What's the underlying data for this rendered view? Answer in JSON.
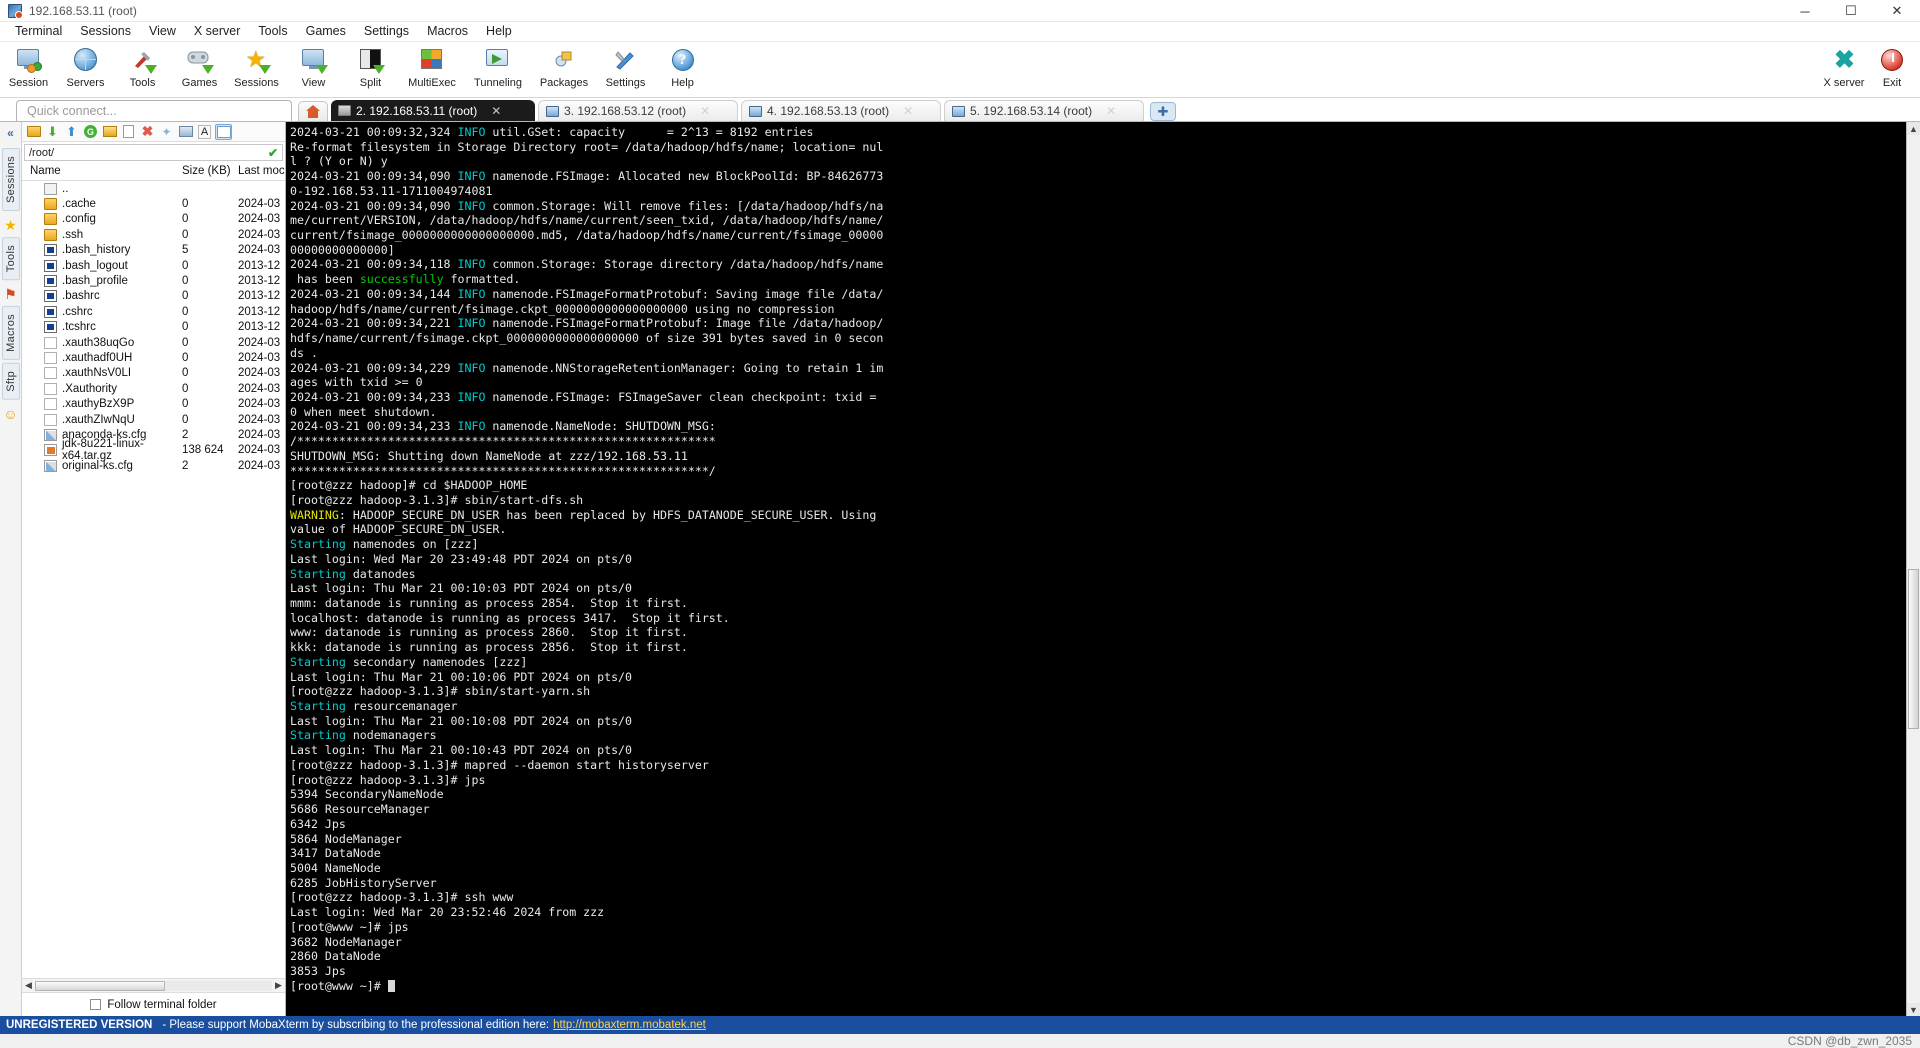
{
  "window": {
    "title": "192.168.53.11 (root)",
    "icon": "mobaxterm-icon",
    "minimize": "─",
    "maximize": "☐",
    "close": "✕"
  },
  "menubar": {
    "items": [
      "Terminal",
      "Sessions",
      "View",
      "X server",
      "Tools",
      "Games",
      "Settings",
      "Macros",
      "Help"
    ]
  },
  "toolbar": {
    "buttons": [
      {
        "label": "Session",
        "icon": "session-icon"
      },
      {
        "label": "Servers",
        "icon": "servers-globe-icon"
      },
      {
        "label": "Tools",
        "icon": "tools-wrench-icon"
      },
      {
        "label": "Games",
        "icon": "games-gamepad-icon"
      },
      {
        "label": "Sessions",
        "icon": "sessions-star-icon"
      },
      {
        "label": "View",
        "icon": "view-monitor-icon"
      },
      {
        "label": "Split",
        "icon": "split-icon"
      },
      {
        "label": "MultiExec",
        "icon": "multiexec-icon"
      },
      {
        "label": "Tunneling",
        "icon": "tunneling-icon"
      },
      {
        "label": "Packages",
        "icon": "packages-icon"
      },
      {
        "label": "Settings",
        "icon": "settings-icon"
      },
      {
        "label": "Help",
        "icon": "help-icon"
      }
    ],
    "right_buttons": [
      {
        "label": "X server",
        "icon": "xserver-icon"
      },
      {
        "label": "Exit",
        "icon": "exit-power-icon"
      }
    ]
  },
  "quick_connect": {
    "placeholder": "Quick connect..."
  },
  "tabs": {
    "home_icon": "home-icon",
    "new_tab_icon": "plus-icon",
    "close_glyph": "✕",
    "items": [
      {
        "label": "2. 192.168.53.11 (root)",
        "active": true
      },
      {
        "label": "3. 192.168.53.12 (root)",
        "active": false
      },
      {
        "label": "4. 192.168.53.13 (root)",
        "active": false
      },
      {
        "label": "5. 192.168.53.14 (root)",
        "active": false
      }
    ]
  },
  "rail": {
    "collapse": "«",
    "tabs": [
      "Sessions",
      "Tools",
      "Macros",
      "Sftp"
    ],
    "icons": [
      "star-icon",
      "flag-icon",
      "clock-icon",
      "smiley-icon"
    ]
  },
  "sftp": {
    "toolbar_icons": [
      "parent-folder-icon",
      "download-icon",
      "upload-icon",
      "refresh-icon",
      "new-folder-icon",
      "new-file-icon",
      "delete-icon",
      "permissions-icon",
      "terminal-icon",
      "text-mode-icon",
      "list-view-icon"
    ],
    "path": "/root/",
    "path_ok_icon": "checkmark-icon",
    "columns": [
      "Name",
      "Size (KB)",
      "Last moc"
    ],
    "rows": [
      {
        "name": "..",
        "size": "",
        "date": "",
        "icon": "parent-dir-icon"
      },
      {
        "name": ".cache",
        "size": "0",
        "date": "2024-03",
        "icon": "folder-icon"
      },
      {
        "name": ".config",
        "size": "0",
        "date": "2024-03",
        "icon": "folder-icon"
      },
      {
        "name": ".ssh",
        "size": "0",
        "date": "2024-03",
        "icon": "folder-icon"
      },
      {
        "name": ".bash_history",
        "size": "5",
        "date": "2024-03",
        "icon": "script-icon"
      },
      {
        "name": ".bash_logout",
        "size": "0",
        "date": "2013-12",
        "icon": "script-icon"
      },
      {
        "name": ".bash_profile",
        "size": "0",
        "date": "2013-12",
        "icon": "script-icon"
      },
      {
        "name": ".bashrc",
        "size": "0",
        "date": "2013-12",
        "icon": "script-icon"
      },
      {
        "name": ".cshrc",
        "size": "0",
        "date": "2013-12",
        "icon": "script-icon"
      },
      {
        "name": ".tcshrc",
        "size": "0",
        "date": "2013-12",
        "icon": "script-icon"
      },
      {
        "name": ".xauth38uqGo",
        "size": "0",
        "date": "2024-03",
        "icon": "plain-file-icon"
      },
      {
        "name": ".xauthadf0UH",
        "size": "0",
        "date": "2024-03",
        "icon": "plain-file-icon"
      },
      {
        "name": ".xauthNsV0LI",
        "size": "0",
        "date": "2024-03",
        "icon": "plain-file-icon"
      },
      {
        "name": ".Xauthority",
        "size": "0",
        "date": "2024-03",
        "icon": "plain-file-icon"
      },
      {
        "name": ".xauthyBzX9P",
        "size": "0",
        "date": "2024-03",
        "icon": "plain-file-icon"
      },
      {
        "name": ".xauthZIwNqU",
        "size": "0",
        "date": "2024-03",
        "icon": "plain-file-icon"
      },
      {
        "name": "anaconda-ks.cfg",
        "size": "2",
        "date": "2024-03",
        "icon": "cfg-file-icon"
      },
      {
        "name": "jdk-8u221-linux-x64.tar.gz",
        "size": "138 624",
        "date": "2024-03",
        "icon": "archive-icon"
      },
      {
        "name": "original-ks.cfg",
        "size": "2",
        "date": "2024-03",
        "icon": "cfg-file-icon"
      }
    ],
    "follow_label": "Follow terminal folder",
    "scroll_left": "◀",
    "scroll_right": "▶"
  },
  "terminal": {
    "scroll_up": "▲",
    "scroll_down": "▼",
    "lines": [
      [
        {
          "t": "2024-03-21 00:09:32,324 ",
          "c": "wh"
        },
        {
          "t": "INFO",
          "c": "cy"
        },
        {
          "t": " util.GSet: capacity      = 2^13 = 8192 entries",
          "c": "wh"
        }
      ],
      [
        {
          "t": "Re-format filesystem in Storage Directory root= /data/hadoop/hdfs/name; location= nul",
          "c": "wh"
        }
      ],
      [
        {
          "t": "l ? (Y or N) y",
          "c": "wh"
        }
      ],
      [
        {
          "t": "2024-03-21 00:09:34,090 ",
          "c": "wh"
        },
        {
          "t": "INFO",
          "c": "cy"
        },
        {
          "t": " namenode.FSImage: Allocated new BlockPoolId: BP-84626773",
          "c": "wh"
        }
      ],
      [
        {
          "t": "0-192.168.53.11-1711004974081",
          "c": "wh"
        }
      ],
      [
        {
          "t": "2024-03-21 00:09:34,090 ",
          "c": "wh"
        },
        {
          "t": "INFO",
          "c": "cy"
        },
        {
          "t": " common.Storage: Will remove files: [/data/hadoop/hdfs/na",
          "c": "wh"
        }
      ],
      [
        {
          "t": "me/current/VERSION, /data/hadoop/hdfs/name/current/seen_txid, /data/hadoop/hdfs/name/",
          "c": "wh"
        }
      ],
      [
        {
          "t": "current/fsimage_0000000000000000000.md5, /data/hadoop/hdfs/name/current/fsimage_00000",
          "c": "wh"
        }
      ],
      [
        {
          "t": "00000000000000]",
          "c": "wh"
        }
      ],
      [
        {
          "t": "2024-03-21 00:09:34,118 ",
          "c": "wh"
        },
        {
          "t": "INFO",
          "c": "cy"
        },
        {
          "t": " common.Storage: Storage directory /data/hadoop/hdfs/name",
          "c": "wh"
        }
      ],
      [
        {
          "t": " has been ",
          "c": "wh"
        },
        {
          "t": "successfully",
          "c": "gr"
        },
        {
          "t": " formatted.",
          "c": "wh"
        }
      ],
      [
        {
          "t": "2024-03-21 00:09:34,144 ",
          "c": "wh"
        },
        {
          "t": "INFO",
          "c": "cy"
        },
        {
          "t": " namenode.FSImageFormatProtobuf: Saving image file /data/",
          "c": "wh"
        }
      ],
      [
        {
          "t": "hadoop/hdfs/name/current/fsimage.ckpt_0000000000000000000 using no compression",
          "c": "wh"
        }
      ],
      [
        {
          "t": "2024-03-21 00:09:34,221 ",
          "c": "wh"
        },
        {
          "t": "INFO",
          "c": "cy"
        },
        {
          "t": " namenode.FSImageFormatProtobuf: Image file /data/hadoop/",
          "c": "wh"
        }
      ],
      [
        {
          "t": "hdfs/name/current/fsimage.ckpt_0000000000000000000 of size 391 bytes saved in 0 secon",
          "c": "wh"
        }
      ],
      [
        {
          "t": "ds .",
          "c": "wh"
        }
      ],
      [
        {
          "t": "2024-03-21 00:09:34,229 ",
          "c": "wh"
        },
        {
          "t": "INFO",
          "c": "cy"
        },
        {
          "t": " namenode.NNStorageRetentionManager: Going to retain 1 im",
          "c": "wh"
        }
      ],
      [
        {
          "t": "ages with txid >= 0",
          "c": "wh"
        }
      ],
      [
        {
          "t": "2024-03-21 00:09:34,233 ",
          "c": "wh"
        },
        {
          "t": "INFO",
          "c": "cy"
        },
        {
          "t": " namenode.FSImage: FSImageSaver clean checkpoint: txid =",
          "c": "wh"
        }
      ],
      [
        {
          "t": "0 when meet shutdown.",
          "c": "wh"
        }
      ],
      [
        {
          "t": "2024-03-21 00:09:34,233 ",
          "c": "wh"
        },
        {
          "t": "INFO",
          "c": "cy"
        },
        {
          "t": " namenode.NameNode: SHUTDOWN_MSG:",
          "c": "wh"
        }
      ],
      [
        {
          "t": "/************************************************************",
          "c": "wh"
        }
      ],
      [
        {
          "t": "SHUTDOWN_MSG: Shutting down NameNode at zzz/192.168.53.11",
          "c": "wh"
        }
      ],
      [
        {
          "t": "************************************************************/",
          "c": "wh"
        }
      ],
      [
        {
          "t": "[root@zzz hadoop]# cd $HADOOP_HOME",
          "c": "wh"
        }
      ],
      [
        {
          "t": "[root@zzz hadoop-3.1.3]# sbin/start-dfs.sh",
          "c": "wh"
        }
      ],
      [
        {
          "t": "WARNING",
          "c": "ye"
        },
        {
          "t": ": HADOOP_SECURE_DN_USER has been replaced by HDFS_DATANODE_SECURE_USER. Using",
          "c": "wh"
        }
      ],
      [
        {
          "t": "value of HADOOP_SECURE_DN_USER.",
          "c": "wh"
        }
      ],
      [
        {
          "t": "Starting",
          "c": "cy"
        },
        {
          "t": " namenodes on [zzz]",
          "c": "wh"
        }
      ],
      [
        {
          "t": "Last login: Wed Mar 20 23:49:48 PDT 2024 on pts/0",
          "c": "wh"
        }
      ],
      [
        {
          "t": "Starting",
          "c": "cy"
        },
        {
          "t": " datanodes",
          "c": "wh"
        }
      ],
      [
        {
          "t": "Last login: Thu Mar 21 00:10:03 PDT 2024 on pts/0",
          "c": "wh"
        }
      ],
      [
        {
          "t": "mmm: datanode is running as process 2854.  Stop it first.",
          "c": "wh"
        }
      ],
      [
        {
          "t": "localhost: datanode is running as process 3417.  Stop it first.",
          "c": "wh"
        }
      ],
      [
        {
          "t": "www: datanode is running as process 2860.  Stop it first.",
          "c": "wh"
        }
      ],
      [
        {
          "t": "kkk: datanode is running as process 2856.  Stop it first.",
          "c": "wh"
        }
      ],
      [
        {
          "t": "Starting",
          "c": "cy"
        },
        {
          "t": " secondary namenodes [zzz]",
          "c": "wh"
        }
      ],
      [
        {
          "t": "Last login: Thu Mar 21 00:10:06 PDT 2024 on pts/0",
          "c": "wh"
        }
      ],
      [
        {
          "t": "[root@zzz hadoop-3.1.3]# sbin/start-yarn.sh",
          "c": "wh"
        }
      ],
      [
        {
          "t": "Starting",
          "c": "cy"
        },
        {
          "t": " resourcemanager",
          "c": "wh"
        }
      ],
      [
        {
          "t": "Last login: Thu Mar 21 00:10:08 PDT 2024 on pts/0",
          "c": "wh"
        }
      ],
      [
        {
          "t": "Starting",
          "c": "cy"
        },
        {
          "t": " nodemanagers",
          "c": "wh"
        }
      ],
      [
        {
          "t": "Last login: Thu Mar 21 00:10:43 PDT 2024 on pts/0",
          "c": "wh"
        }
      ],
      [
        {
          "t": "[root@zzz hadoop-3.1.3]# mapred --daemon start historyserver",
          "c": "wh"
        }
      ],
      [
        {
          "t": "[root@zzz hadoop-3.1.3]# jps",
          "c": "wh"
        }
      ],
      [
        {
          "t": "5394 SecondaryNameNode",
          "c": "wh"
        }
      ],
      [
        {
          "t": "5686 ResourceManager",
          "c": "wh"
        }
      ],
      [
        {
          "t": "6342 Jps",
          "c": "wh"
        }
      ],
      [
        {
          "t": "5864 NodeManager",
          "c": "wh"
        }
      ],
      [
        {
          "t": "3417 DataNode",
          "c": "wh"
        }
      ],
      [
        {
          "t": "5004 NameNode",
          "c": "wh"
        }
      ],
      [
        {
          "t": "6285 JobHistoryServer",
          "c": "wh"
        }
      ],
      [
        {
          "t": "[root@zzz hadoop-3.1.3]# ssh www",
          "c": "wh"
        }
      ],
      [
        {
          "t": "Last login: Wed Mar 20 23:52:46 2024 from zzz",
          "c": "wh"
        }
      ],
      [
        {
          "t": "[root@www ~]# jps",
          "c": "wh"
        }
      ],
      [
        {
          "t": "3682 NodeManager",
          "c": "wh"
        }
      ],
      [
        {
          "t": "2860 DataNode",
          "c": "wh"
        }
      ],
      [
        {
          "t": "3853 Jps",
          "c": "wh"
        }
      ],
      [
        {
          "t": "[root@www ~]# ",
          "c": "wh",
          "cursor": true
        }
      ]
    ]
  },
  "statusbar": {
    "unregistered": "UNREGISTERED VERSION",
    "message": "-  Please support MobaXterm by subscribing to the professional edition here:",
    "link": "http://mobaxterm.mobatek.net",
    "watermark": "CSDN @db_zwn_2035"
  },
  "colors": {
    "status_bg": "#1a4fa0",
    "terminal_bg": "#000000",
    "accent_cyan": "#00cdcd",
    "accent_green": "#00cd00",
    "accent_yellow": "#e5e500",
    "tab_active_bg": "#1b1b1b"
  }
}
